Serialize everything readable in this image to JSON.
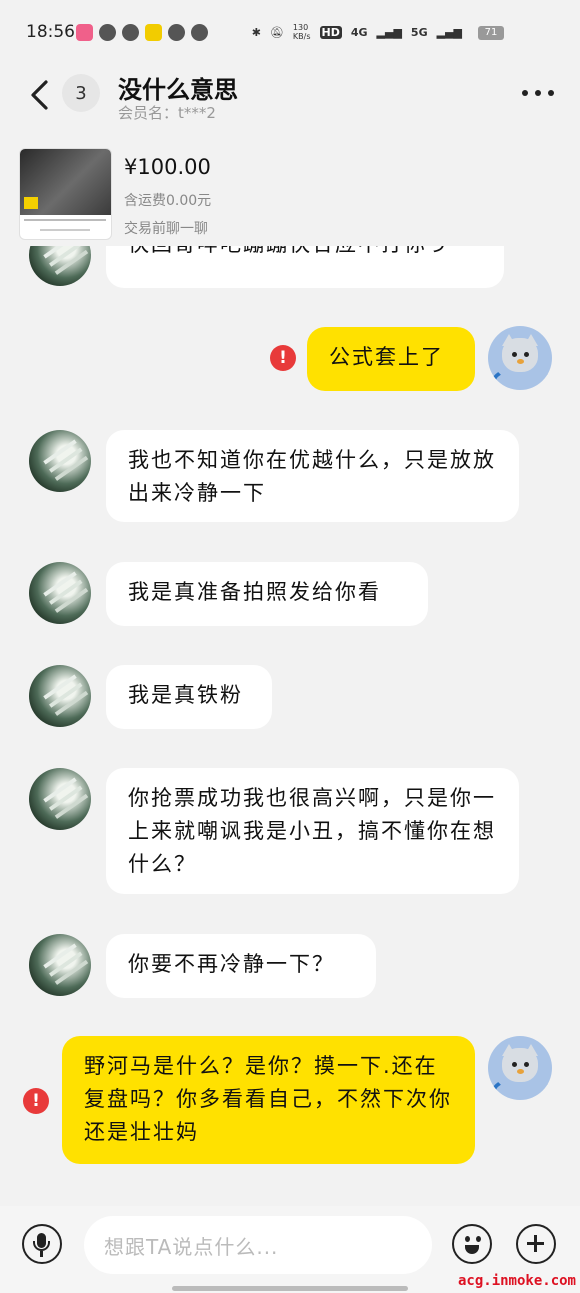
{
  "status_bar": {
    "time": "18:56",
    "network_speed": "130\nKB/s",
    "hd_label": "HD",
    "net_4g": "4G",
    "net_5g": "5G",
    "battery": "71"
  },
  "header": {
    "unread_count": "3",
    "title": "没什么意思",
    "member": "会员名：t***2"
  },
  "product": {
    "price": "¥100.00",
    "shipping": "含运费0.00元",
    "pre_chat": "交易前聊一聊"
  },
  "messages": [
    {
      "side": "in",
      "text": "快回哥哔吧蹦蹦快合应不打你う"
    },
    {
      "side": "out",
      "text": "公式套上了",
      "failed": true
    },
    {
      "side": "in",
      "text": "我也不知道你在优越什么，只是放放出来冷静一下"
    },
    {
      "side": "in",
      "text": "我是真准备拍照发给你看"
    },
    {
      "side": "in",
      "text": "我是真铁粉"
    },
    {
      "side": "in",
      "text": "你抢票成功我也很高兴啊，只是你一上来就嘲讽我是小丑，搞不懂你在想什么？"
    },
    {
      "side": "in",
      "text": "你要不再冷静一下？"
    },
    {
      "side": "out",
      "text": "野河马是什么？是你？摸一下.还在复盘吗？你多看看自己，不然下次你还是壮壮妈",
      "failed": true
    }
  ],
  "input": {
    "placeholder": "想跟TA说点什么..."
  },
  "watermark": "acg.inmoke.com",
  "colors": {
    "outgoing_bubble": "#ffe100",
    "incoming_bubble": "#ffffff",
    "error_badge": "#e83a3a",
    "background": "#f2f2f2"
  },
  "icons": [
    "back-arrow-icon",
    "more-icon",
    "error-icon",
    "microphone-icon",
    "emoji-icon",
    "plus-icon"
  ]
}
